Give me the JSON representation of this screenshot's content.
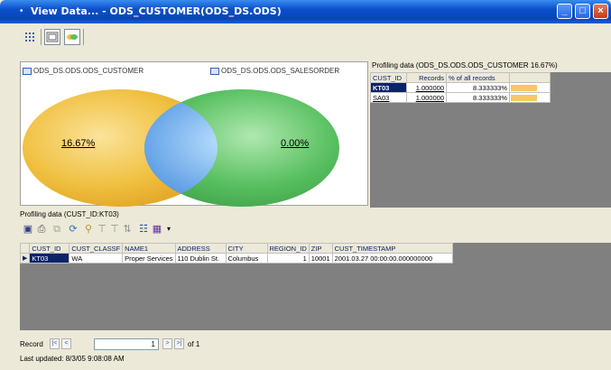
{
  "window": {
    "title": "View Data... - ODS_CUSTOMER(ODS_DS.ODS)",
    "buttons": [
      "minimize",
      "maximize",
      "close"
    ]
  },
  "toolbar": {
    "buttons": [
      {
        "icon": "grid-view-icon",
        "active": false
      },
      {
        "icon": "chart-view-icon",
        "active": true
      },
      {
        "icon": "venn-view-icon",
        "active": true
      }
    ]
  },
  "venn": {
    "left_table": "ODS_DS.ODS.ODS_CUSTOMER",
    "right_table": "ODS_DS.ODS.ODS_SALESORDER",
    "left_value": "16.67%",
    "right_value": "0.00%",
    "colors": {
      "left": "#f0c040",
      "right": "#58c060",
      "overlap": "#5aa0e8"
    }
  },
  "profile_top": {
    "title": "Profiling data (ODS_DS.ODS.ODS_CUSTOMER 16.67%)",
    "columns": [
      "CUST_ID",
      "Records",
      "% of all records"
    ],
    "rows": [
      {
        "cust_id": "KT03",
        "records": "1.000000",
        "percent": "8.333333%",
        "fill": 0.65
      },
      {
        "cust_id": "SA03",
        "records": "1.000000",
        "percent": "8.333333%",
        "fill": 0.65
      }
    ]
  },
  "profile_bottom": {
    "title": "Profiling data (CUST_ID:KT03)",
    "columns": [
      "CUST_ID",
      "CUST_CLASSF",
      "NAME1",
      "ADDRESS",
      "CITY",
      "REGION_ID",
      "ZIP",
      "CUST_TIMESTAMP"
    ],
    "rows": [
      [
        "KT03",
        "WA",
        "Proper Services",
        "110 Dublin St.",
        "Columbus",
        "1",
        "10001",
        "2001.03.27 00:00:00.000000000"
      ]
    ]
  },
  "navigator": {
    "label": "Record",
    "current": "1",
    "of_label": "of 1",
    "buttons": [
      "|<",
      "<",
      ">",
      ">|"
    ]
  },
  "status": {
    "last_updated": "Last updated: 8/3/05 9:08:08 AM"
  }
}
